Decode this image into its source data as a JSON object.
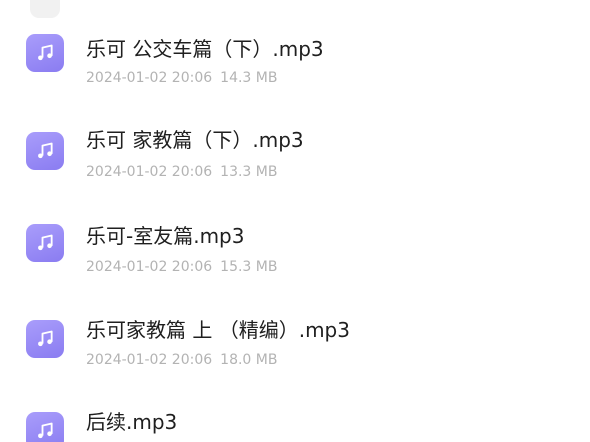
{
  "files": [
    {
      "name": "乐可 公交车篇（下）.mp3",
      "date": "2024-01-02 20:06",
      "size": "14.3 MB"
    },
    {
      "name": "乐可 家教篇（下）.mp3",
      "date": "2024-01-02 20:06",
      "size": "13.3 MB"
    },
    {
      "name": "乐可-室友篇.mp3",
      "date": "2024-01-02 20:06",
      "size": "15.3 MB"
    },
    {
      "name": "乐可家教篇 上 （精编）.mp3",
      "date": "2024-01-02 20:06",
      "size": "18.0 MB"
    },
    {
      "name": "后续.mp3"
    }
  ],
  "icons": {
    "file": "music-note-icon"
  },
  "colors": {
    "icon_bg": "#8a7cf1",
    "name_text": "#1f1f1f",
    "meta_text": "#b3b3b3"
  }
}
